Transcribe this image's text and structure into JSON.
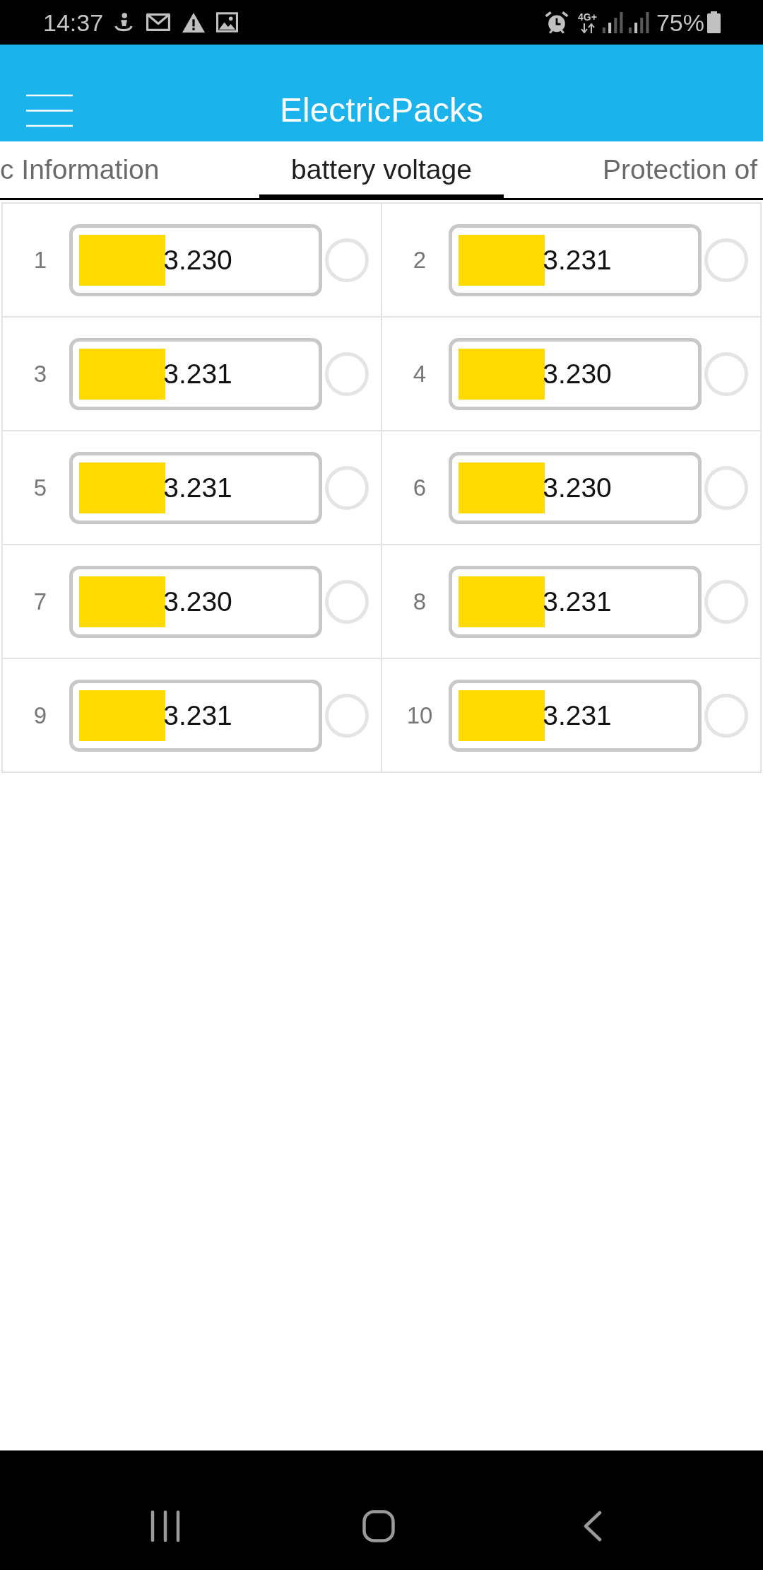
{
  "status_bar": {
    "time": "14:37",
    "network_type": "4G+",
    "battery_percent": "75%"
  },
  "app_bar": {
    "title": "ElectricPacks"
  },
  "tabs": [
    {
      "label": "c Information",
      "selected": false
    },
    {
      "label": "battery voltage",
      "selected": true
    },
    {
      "label": "Protection of",
      "selected": false
    }
  ],
  "cells": [
    {
      "number": "1",
      "reading": "3.230",
      "level": 0.37
    },
    {
      "number": "2",
      "reading": "3.231",
      "level": 0.37
    },
    {
      "number": "3",
      "reading": "3.231",
      "level": 0.37
    },
    {
      "number": "4",
      "reading": "3.230",
      "level": 0.37
    },
    {
      "number": "5",
      "reading": "3.231",
      "level": 0.37
    },
    {
      "number": "6",
      "reading": "3.230",
      "level": 0.37
    },
    {
      "number": "7",
      "reading": "3.230",
      "level": 0.37
    },
    {
      "number": "8",
      "reading": "3.231",
      "level": 0.37
    },
    {
      "number": "9",
      "reading": "3.231",
      "level": 0.37
    },
    {
      "number": "10",
      "reading": "3.231",
      "level": 0.37
    }
  ]
}
